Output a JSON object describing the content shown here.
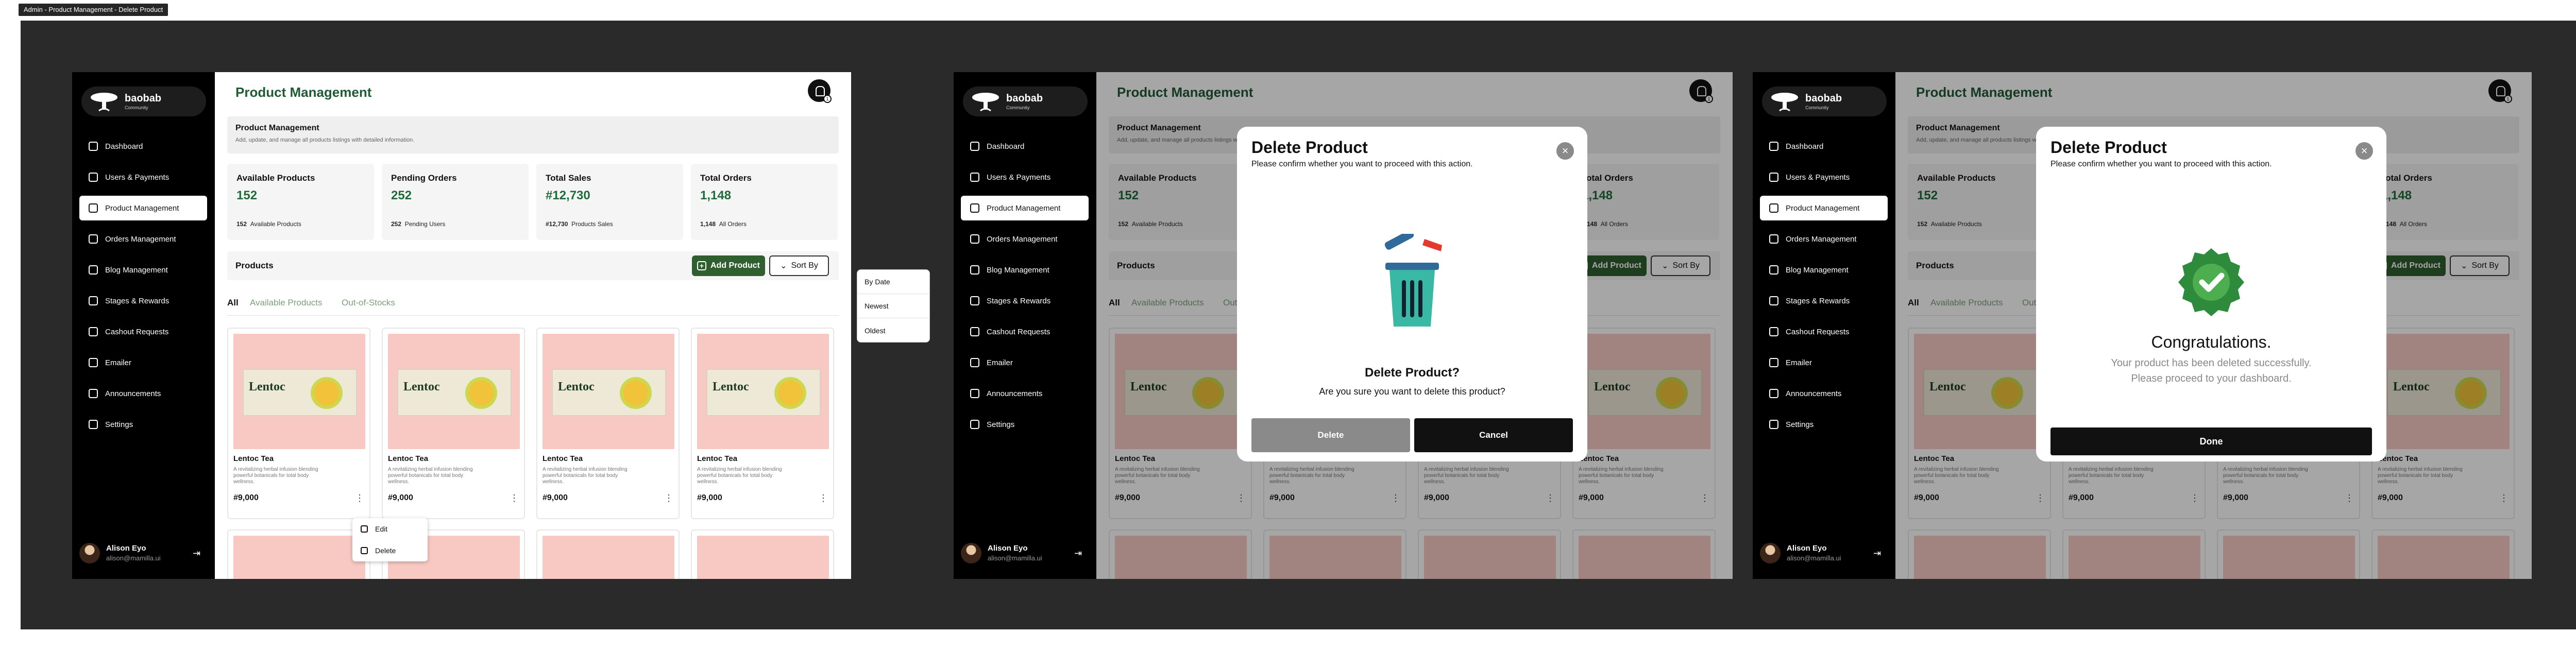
{
  "window_tag": "Admin - Product Management - Delete Product",
  "brand": {
    "name": "baobab",
    "sub": "Community"
  },
  "nav": [
    {
      "label": "Dashboard",
      "active": false
    },
    {
      "label": "Users & Payments",
      "active": false
    },
    {
      "label": "Product Management",
      "active": true
    },
    {
      "label": "Orders Management",
      "active": false
    },
    {
      "label": "Blog Management",
      "active": false
    },
    {
      "label": "Stages & Rewards",
      "active": false
    },
    {
      "label": "Cashout Requests",
      "active": false
    },
    {
      "label": "Emailer",
      "active": false
    },
    {
      "label": "Announcements",
      "active": false
    },
    {
      "label": "Settings",
      "active": false
    }
  ],
  "user": {
    "name": "Alison Eyo",
    "email": "alison@mamilla.ui"
  },
  "page": {
    "title": "Product Management",
    "notify_count": "1"
  },
  "banner": {
    "title": "Product Management",
    "subtitle": "Add, update, and manage all products listings with detailed information."
  },
  "stats": [
    {
      "label": "Available Products",
      "value": "152",
      "note_value": "152",
      "note_label": "Available Products"
    },
    {
      "label": "Pending Orders",
      "value": "252",
      "note_value": "252",
      "note_label": "Pending Users"
    },
    {
      "label": "Total Sales",
      "value": "#12,730",
      "note_value": "#12,730",
      "note_label": "Products Sales"
    },
    {
      "label": "Total Orders",
      "value": "1,148",
      "note_value": "1,148",
      "note_label": "All Orders"
    }
  ],
  "products_bar": {
    "title": "Products",
    "add_label": "Add Product",
    "sort_label": "Sort By"
  },
  "tabs": [
    "All",
    "Available Products",
    "Out-of-Stocks"
  ],
  "products": [
    {
      "name": "Lentoc Tea",
      "desc": "A revitalizing herbal infusion blending powerful botanicals for total body wellness.",
      "price": "#9,000"
    },
    {
      "name": "Lentoc Tea",
      "desc": "A revitalizing herbal infusion blending powerful botanicals for total body wellness.",
      "price": "#9,000"
    },
    {
      "name": "Lentoc Tea",
      "desc": "A revitalizing herbal infusion blending powerful botanicals for total body wellness.",
      "price": "#9,000"
    },
    {
      "name": "Lentoc Tea",
      "desc": "A revitalizing herbal infusion blending powerful botanicals for total body wellness.",
      "price": "#9,000"
    }
  ],
  "pack_label": "Lentoc",
  "context_menu": {
    "edit": "Edit",
    "delete": "Delete"
  },
  "sort_options": [
    "By Date",
    "Newest",
    "Oldest"
  ],
  "modal_delete": {
    "title": "Delete Product",
    "subtitle": "Please confirm whether you want to proceed with this action.",
    "question": "Delete Product?",
    "ask": "Are you sure you want to delete this product?",
    "delete_label": "Delete",
    "cancel_label": "Cancel"
  },
  "modal_success": {
    "title": "Delete Product",
    "subtitle": "Please confirm whether you want to proceed with this action.",
    "congrats": "Congratulations.",
    "message": "Your product has been deleted successfully. Please proceed to your dashboard.",
    "done_label": "Done"
  },
  "colors": {
    "brand_green": "#2f5e2f",
    "value_green": "#1f6b3b",
    "card_bg": "#f8c9c3",
    "sidebar": "#000000"
  }
}
